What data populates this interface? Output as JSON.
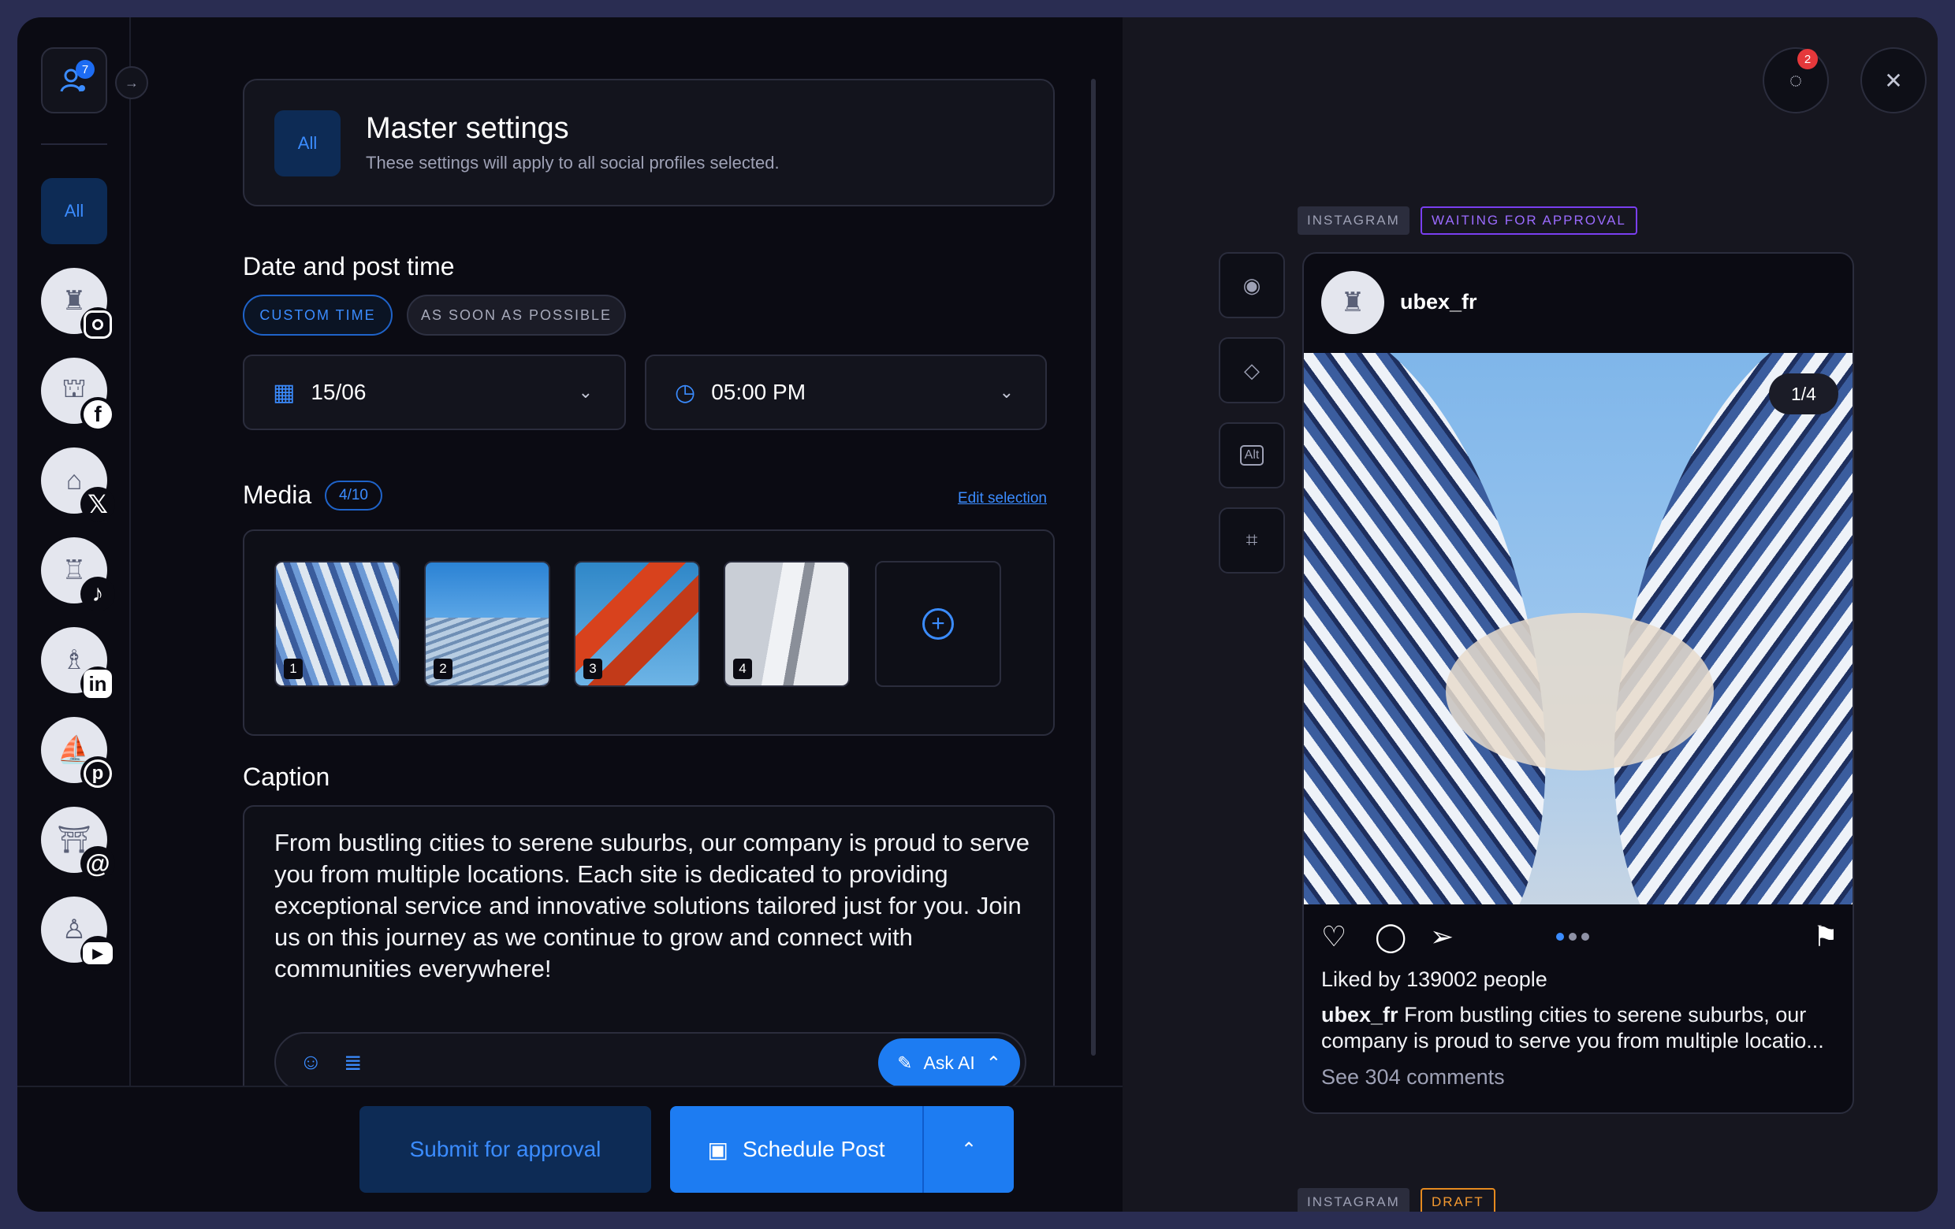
{
  "rail": {
    "notification_count": "7",
    "all_label": "All",
    "profiles": [
      {
        "network": "Instagram",
        "icon": "instagram-icon",
        "color": "#0b0b13"
      },
      {
        "network": "Facebook",
        "icon": "facebook-icon",
        "color": "#1877f2"
      },
      {
        "network": "X",
        "icon": "x-icon",
        "color": "#0b0b13"
      },
      {
        "network": "TikTok",
        "icon": "tiktok-icon",
        "color": "#0b0b13"
      },
      {
        "network": "LinkedIn",
        "icon": "linkedin-icon",
        "color": "#0b0b13"
      },
      {
        "network": "Pinterest",
        "icon": "pinterest-icon",
        "color": "#0b0b13"
      },
      {
        "network": "Threads",
        "icon": "threads-icon",
        "color": "#0b0b13"
      },
      {
        "network": "YouTube",
        "icon": "youtube-icon",
        "color": "#0b0b13"
      }
    ]
  },
  "master": {
    "tag": "All",
    "title": "Master settings",
    "subtitle": "These settings will apply to all social profiles selected."
  },
  "schedule": {
    "heading": "Date and post time",
    "custom_time": "CUSTOM TIME",
    "asap": "AS SOON AS POSSIBLE",
    "date": "15/06",
    "time": "05:00 PM"
  },
  "media": {
    "heading": "Media",
    "count": "4/10",
    "edit_link": "Edit selection",
    "thumbs": [
      "1",
      "2",
      "3",
      "4"
    ]
  },
  "caption": {
    "heading": "Caption",
    "text": "From bustling cities to serene suburbs, our company is proud to serve you from multiple locations. Each site is dedicated to providing exceptional service and innovative solutions tailored just for you. Join us on this journey as we continue to grow and connect with communities everywhere!",
    "ask_ai": "Ask AI"
  },
  "footer": {
    "submit_label": "Submit for approval",
    "schedule_label": "Schedule Post"
  },
  "preview": {
    "notification_count": "2",
    "platform": "INSTAGRAM",
    "status": "WAITING FOR APPROVAL",
    "username": "ubex_fr",
    "image_counter": "1/4",
    "liked_by": "Liked by 139002 people",
    "caption_user": "ubex_fr",
    "caption_text": "From bustling cities to serene suburbs, our company is proud to serve you from multiple locatio...",
    "comments": "See 304 comments",
    "next_platform": "INSTAGRAM",
    "next_status": "DRAFT"
  },
  "colors": {
    "accent": "#1d7cf2",
    "background": "#0b0b13",
    "panel": "#16161f",
    "waiting": "#7a3ff0",
    "draft": "#e58a1f"
  }
}
